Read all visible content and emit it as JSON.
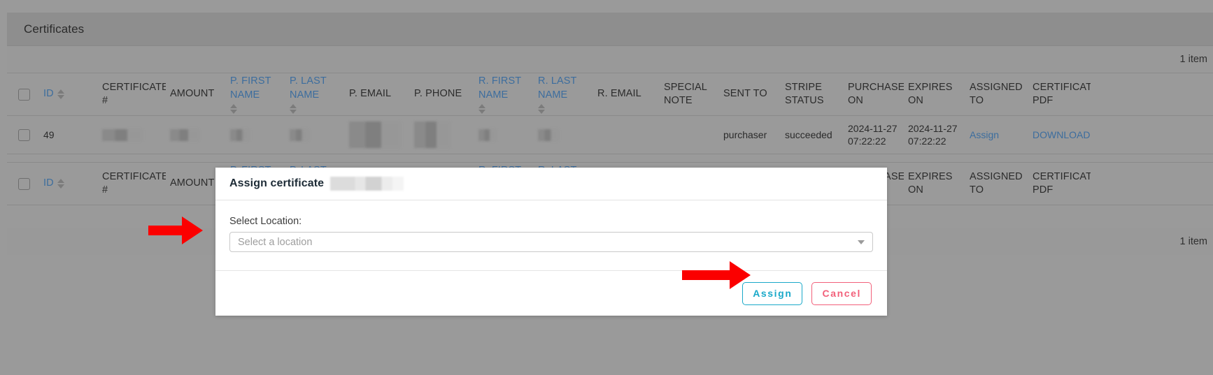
{
  "page": {
    "title": "Certificates",
    "item_count_top": "1 item",
    "item_count_bottom": "1 item"
  },
  "table": {
    "columns": [
      {
        "key": "checkbox",
        "label": "",
        "sortable": false,
        "link": false,
        "stacked": false
      },
      {
        "key": "id",
        "label": "ID",
        "sortable": true,
        "link": true,
        "stacked": false
      },
      {
        "key": "certificate_no",
        "label": "CERTIFICATE #",
        "sortable": false,
        "link": false,
        "stacked": false
      },
      {
        "key": "amount",
        "label": "AMOUNT",
        "sortable": false,
        "link": false,
        "stacked": false
      },
      {
        "key": "p_first_name",
        "label": "P. FIRST NAME",
        "sortable": true,
        "link": true,
        "stacked": true
      },
      {
        "key": "p_last_name",
        "label": "P. LAST NAME",
        "sortable": true,
        "link": true,
        "stacked": true
      },
      {
        "key": "p_email",
        "label": "P. EMAIL",
        "sortable": false,
        "link": false,
        "stacked": false
      },
      {
        "key": "p_phone",
        "label": "P. PHONE",
        "sortable": false,
        "link": false,
        "stacked": false
      },
      {
        "key": "r_first_name",
        "label": "R. FIRST NAME",
        "sortable": true,
        "link": true,
        "stacked": true
      },
      {
        "key": "r_last_name",
        "label": "R. LAST NAME",
        "sortable": true,
        "link": true,
        "stacked": true
      },
      {
        "key": "r_email",
        "label": "R. EMAIL",
        "sortable": false,
        "link": false,
        "stacked": false
      },
      {
        "key": "special_note",
        "label": "SPECIAL NOTE",
        "sortable": false,
        "link": false,
        "stacked": false
      },
      {
        "key": "sent_to",
        "label": "SENT TO",
        "sortable": false,
        "link": false,
        "stacked": false
      },
      {
        "key": "stripe_status",
        "label": "STRIPE STATUS",
        "sortable": false,
        "link": false,
        "stacked": false
      },
      {
        "key": "purchased_on",
        "label": "PURCHASED ON",
        "sortable": false,
        "link": false,
        "stacked": false
      },
      {
        "key": "expires_on",
        "label": "EXPIRES ON",
        "sortable": false,
        "link": false,
        "stacked": false
      },
      {
        "key": "assigned_to",
        "label": "ASSIGNED TO",
        "sortable": false,
        "link": false,
        "stacked": false
      },
      {
        "key": "certificate_pdf",
        "label": "CERTIFICATE PDF",
        "sortable": false,
        "link": false,
        "stacked": false
      }
    ],
    "rows": [
      {
        "id": "49",
        "certificate_no": "",
        "amount": "",
        "p_first_name": "",
        "p_last_name": "",
        "p_email": "",
        "p_phone": "",
        "r_first_name": "",
        "r_last_name": "",
        "r_email": "",
        "special_note": "",
        "sent_to": "purchaser",
        "stripe_status": "succeeded",
        "purchased_on": "2024-11-27 07:22:22",
        "expires_on": "2024-11-27 07:22:22",
        "assigned_to": "Assign",
        "certificate_pdf": "DOWNLOAD"
      }
    ]
  },
  "modal": {
    "title": "Assign certificate",
    "select_label": "Select Location:",
    "select_placeholder": "Select a location",
    "assign_label": "Assign",
    "cancel_label": "Cancel"
  },
  "colors": {
    "accent_link": "#3c6d9e",
    "assign_button": "#1aa9c9",
    "cancel_button": "#f2607a",
    "arrow": "#fb0000",
    "page_background": "#9a9a9a"
  }
}
